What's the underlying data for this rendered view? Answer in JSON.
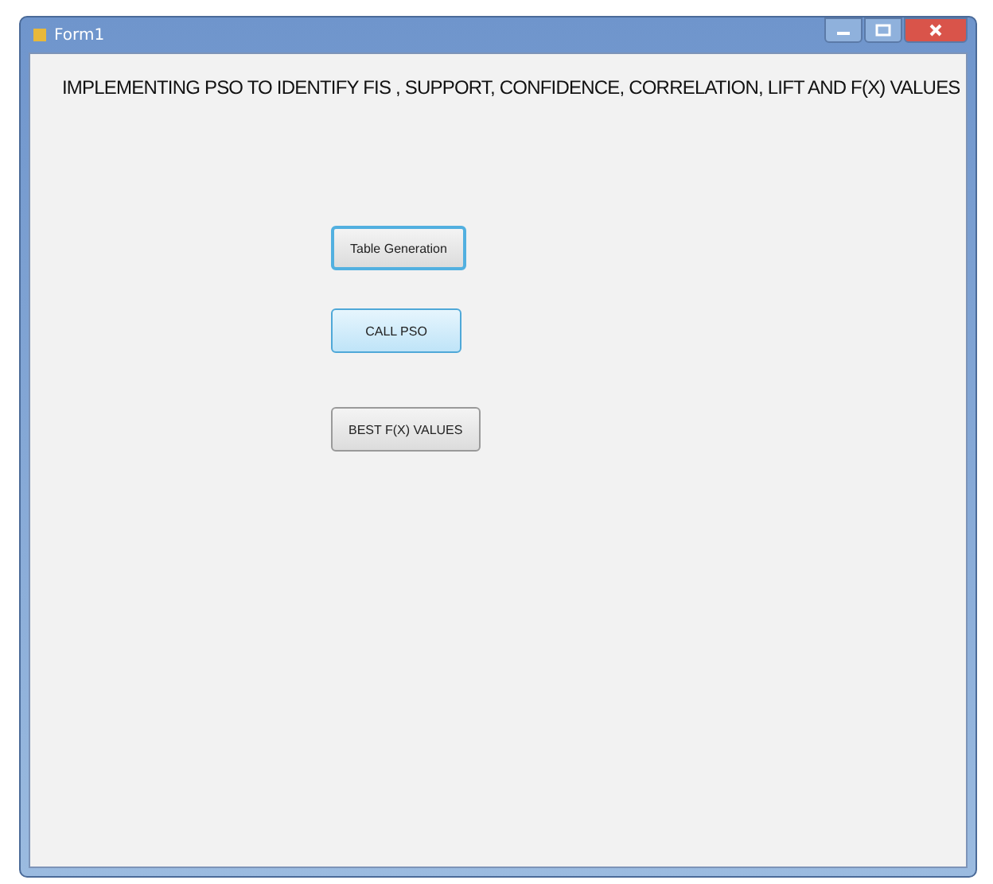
{
  "window": {
    "title": "Form1"
  },
  "heading": "IMPLEMENTING PSO TO IDENTIFY FIS , SUPPORT, CONFIDENCE,  CORRELATION, LIFT AND F(X) VALUES",
  "buttons": [
    {
      "label": "Table Generation",
      "focused": true,
      "hot": false
    },
    {
      "label": "CALL PSO",
      "focused": false,
      "hot": true
    },
    {
      "label": "BEST F(X) VALUES",
      "focused": false,
      "hot": false
    }
  ]
}
